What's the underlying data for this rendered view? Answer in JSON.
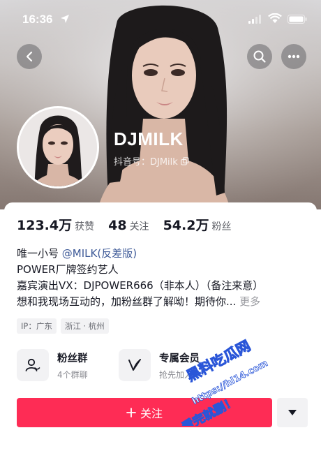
{
  "status_bar": {
    "time": "16:36"
  },
  "profile": {
    "name": "DJMILK",
    "douyin_id": "抖音号：DJMilk"
  },
  "stats": [
    {
      "value": "123.4万",
      "label": "获赞"
    },
    {
      "value": "48",
      "label": "关注"
    },
    {
      "value": "54.2万",
      "label": "粉丝"
    }
  ],
  "bio": {
    "line1_prefix": "唯一小号",
    "line1_mention": "@MILK(反差版)",
    "line2": "POWER厂牌签约艺人",
    "line3": "嘉宾演出VX：DJPOWER666（非本人）（备注来意）",
    "line4": "想和我现场互动的，加粉丝群了解呦！期待你...",
    "more": "更多"
  },
  "tags": [
    "IP：广东",
    "浙江 · 杭州"
  ],
  "features": [
    {
      "title": "粉丝群",
      "subtitle": "4个群聊",
      "icon": "fan-group-icon"
    },
    {
      "title": "专属会员",
      "subtitle": "抢先加入",
      "icon": "membership-v-icon"
    }
  ],
  "follow_button": {
    "label": "关注"
  },
  "watermark": {
    "line1": "黑料吃瓜网",
    "line2": "https://hl14.com",
    "line3": "看完就删！"
  },
  "colors": {
    "accent": "#fe2c55",
    "mention": "#3e5a98"
  }
}
